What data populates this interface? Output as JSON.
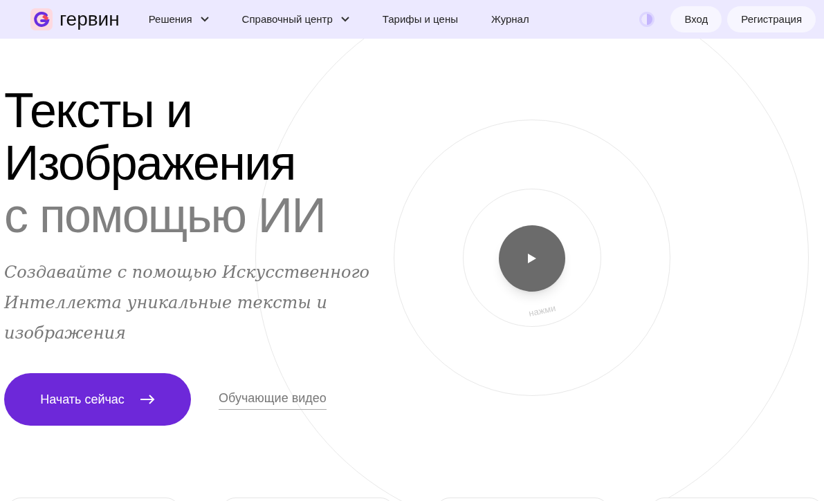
{
  "header": {
    "logo": "гервин",
    "nav": [
      {
        "label": "Решения",
        "dropdown": true
      },
      {
        "label": "Справочный центр",
        "dropdown": true
      },
      {
        "label": "Тарифы и цены",
        "dropdown": false
      },
      {
        "label": "Журнал",
        "dropdown": false
      }
    ],
    "buttons": [
      "Вход",
      "Регистрация"
    ]
  },
  "hero": {
    "title_lines": [
      "Тексты и",
      "Изображения"
    ],
    "title_accent": "с помощью ИИ",
    "subtitle": "Создавайте с помощью Искусственного Интеллекта уникальные тексты и изображения",
    "primary_button": "Начать сейчас",
    "secondary_link": "Обучающие видео",
    "video_caption": "нажми"
  }
}
